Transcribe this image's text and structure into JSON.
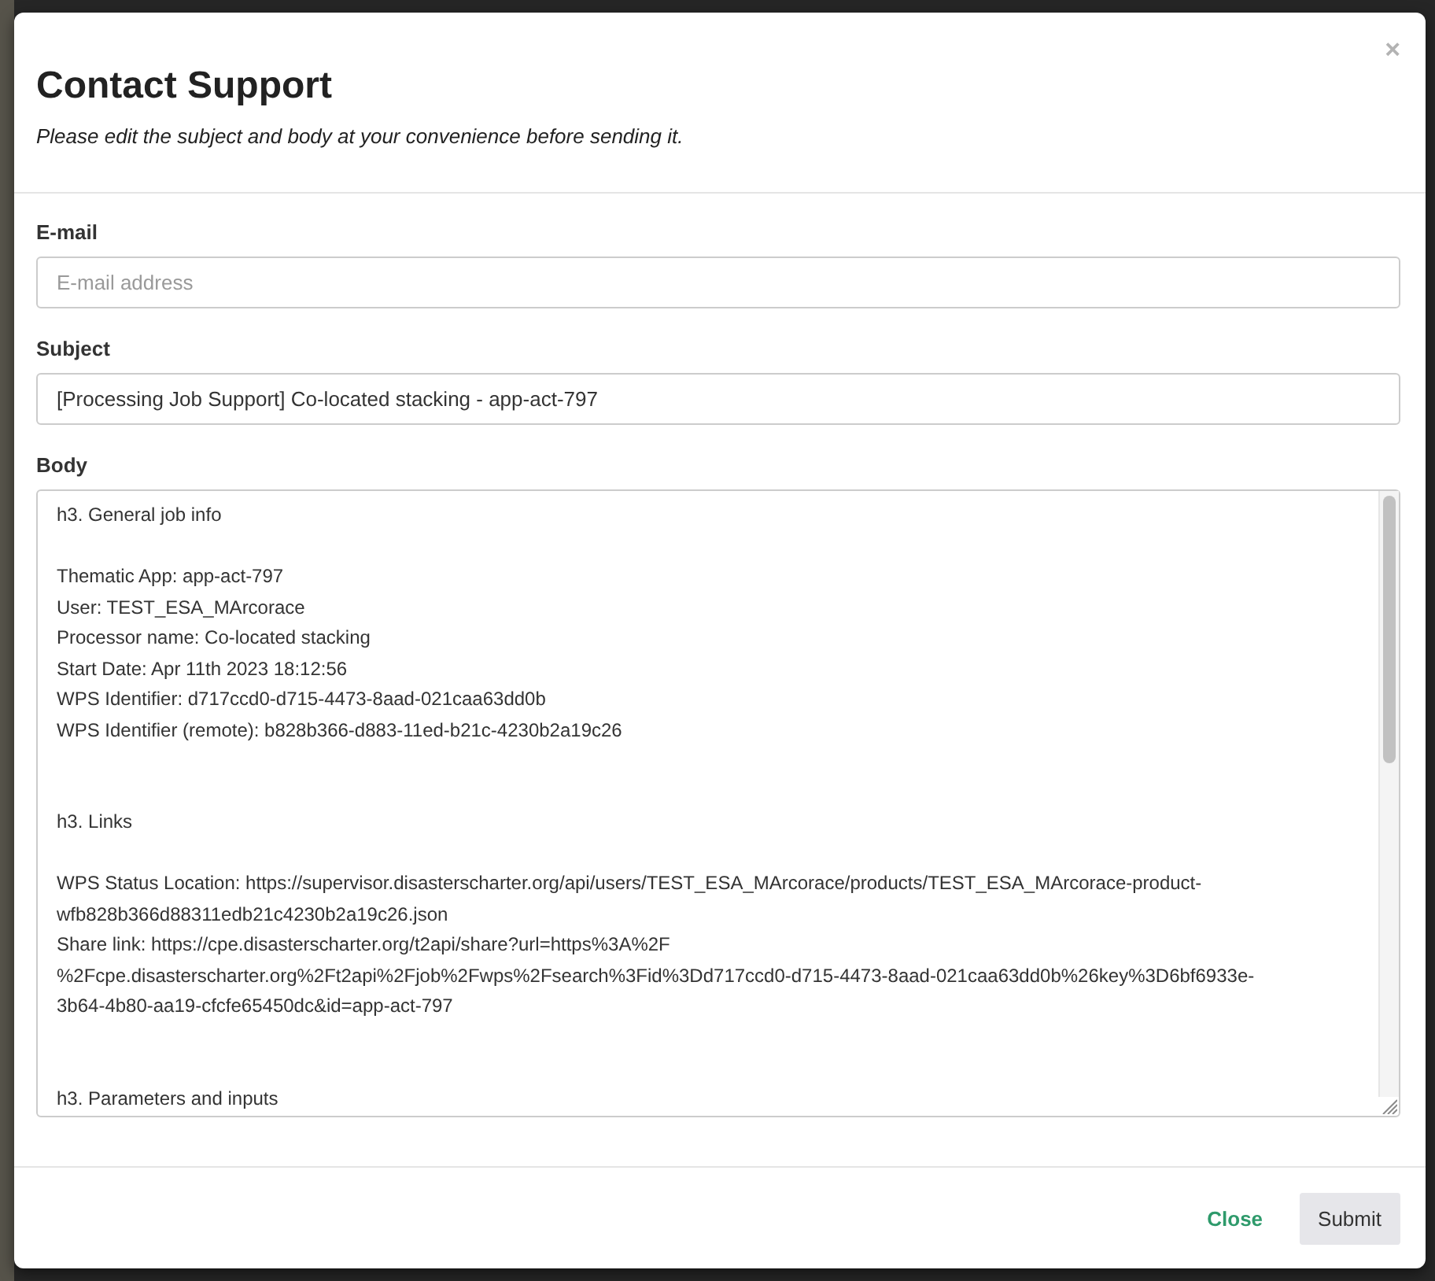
{
  "dialog": {
    "title": "Contact Support",
    "subtitle": "Please edit the subject and body at your convenience before sending it.",
    "close_label": "×"
  },
  "fields": [
    {
      "kind": "input",
      "label": "E-mail",
      "placeholder": "E-mail address"
    },
    {
      "kind": "input",
      "label": "Subject",
      "value": "[Processing Job Support] Co-located stacking - app-act-797"
    },
    {
      "kind": "textarea",
      "label": "Body",
      "value": "h3. General job info\n\nThematic App: app-act-797\nUser: TEST_ESA_MArcorace\nProcessor name: Co-located stacking\nStart Date: Apr 11th 2023 18:12:56\nWPS Identifier: d717ccd0-d715-4473-8aad-021caa63dd0b\nWPS Identifier (remote): b828b366-d883-11ed-b21c-4230b2a19c26\n\n\nh3. Links\n\nWPS Status Location: https://supervisor.disasterscharter.org/api/users/TEST_ESA_MArcorace/products/TEST_ESA_MArcorace-product-\nwfb828b366d88311edb21c4230b2a19c26.json\nShare link: https://cpe.disasterscharter.org/t2api/share?url=https%3A%2F\n%2Fcpe.disasterscharter.org%2Ft2api%2Fjob%2Fwps%2Fsearch%3Fid%3Dd717ccd0-d715-4473-8aad-021caa63dd0b%26key%3D6bf6933e-\n3b64-4b80-aa19-cfcfe65450dc&id=app-act-797\n\n\nh3. Parameters and inputs"
    }
  ],
  "buttons": [
    {
      "kind": "link",
      "label": "Close"
    },
    {
      "kind": "default",
      "label": "Submit"
    }
  ]
}
